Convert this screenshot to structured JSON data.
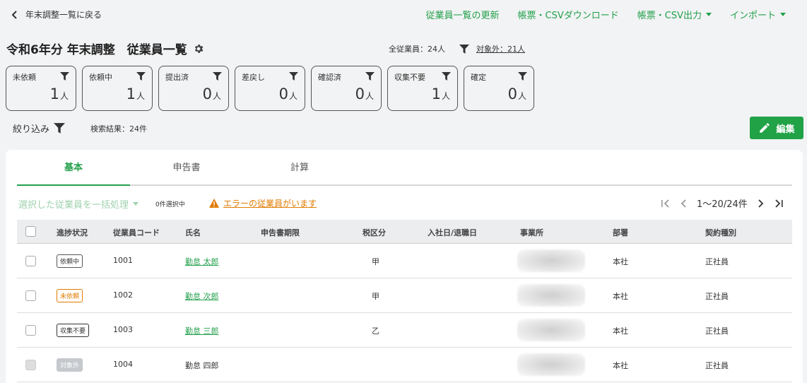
{
  "topbar": {
    "back_label": "年末調整一覧に戻る",
    "links": [
      {
        "label": "従業員一覧の更新",
        "dropdown": false
      },
      {
        "label": "帳票・CSVダウンロード",
        "dropdown": false
      },
      {
        "label": "帳票・CSV出力",
        "dropdown": true
      },
      {
        "label": "インポート",
        "dropdown": true
      }
    ]
  },
  "header": {
    "title": "令和6年分 年末調整　従業員一覧",
    "total_label": "全従業員：24人",
    "excluded_label": "対象外：21人"
  },
  "status_cards": [
    {
      "label": "未依頼",
      "count": "1",
      "unit": "人"
    },
    {
      "label": "依頼中",
      "count": "1",
      "unit": "人"
    },
    {
      "label": "提出済",
      "count": "0",
      "unit": "人"
    },
    {
      "label": "差戻し",
      "count": "0",
      "unit": "人"
    },
    {
      "label": "確認済",
      "count": "0",
      "unit": "人"
    },
    {
      "label": "収集不要",
      "count": "1",
      "unit": "人"
    },
    {
      "label": "確定",
      "count": "0",
      "unit": "人"
    }
  ],
  "filter": {
    "narrow_label": "絞り込み",
    "results_label": "検索結果：24件",
    "edit_label": "編集"
  },
  "tabs": [
    {
      "label": "基本",
      "active": true
    },
    {
      "label": "申告書",
      "active": false
    },
    {
      "label": "計算",
      "active": false
    }
  ],
  "toolbar": {
    "bulk_label": "選択した従業員を一括処理",
    "selected_count": "0件選択中",
    "error_link": "エラーの従業員がいます",
    "pager_range": "1〜20/24件"
  },
  "table": {
    "headers": {
      "status": "進捗状況",
      "code": "従業員コード",
      "name": "氏名",
      "deadline": "申告書期限",
      "tax": "税区分",
      "dates": "入社日/退職日",
      "office": "事業所",
      "dept": "部署",
      "contract": "契約種別"
    },
    "rows": [
      {
        "status": "依頼中",
        "code": "1001",
        "name": "勤怠 太郎",
        "tax": "甲",
        "dept": "本社",
        "contract": "正社員"
      },
      {
        "status": "未依頼",
        "code": "1002",
        "name": "勤怠 次郎",
        "tax": "甲",
        "dept": "本社",
        "contract": "正社員"
      },
      {
        "status": "収集不要",
        "code": "1003",
        "name": "勤怠 三郎",
        "tax": "乙",
        "dept": "本社",
        "contract": "正社員"
      },
      {
        "status": "対象外",
        "code": "1004",
        "name": "勤怠 四郎",
        "tax": "",
        "dept": "本社",
        "contract": "正社員"
      }
    ]
  },
  "colors": {
    "accent": "#22a04b",
    "warning": "#e07b00",
    "disabled": "#c5c8cc"
  }
}
